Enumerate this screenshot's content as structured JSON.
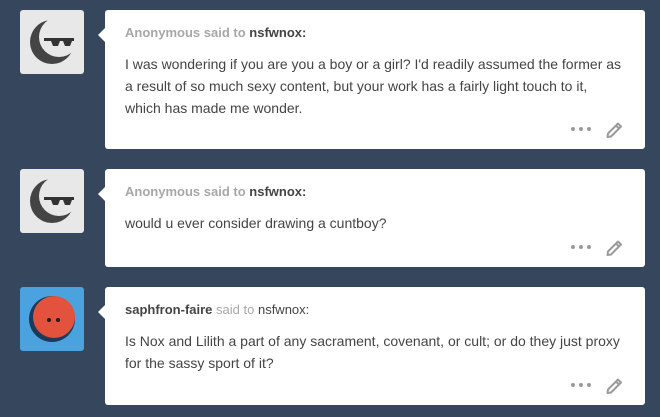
{
  "posts": [
    {
      "asker": "Anonymous",
      "said_to": "said to",
      "recipient": "nsfwnox",
      "colon": ":",
      "question": "I was wondering if you are you a boy or a girl? I'd readily assumed the former as a result of so much sexy content, but your work has a fairly light touch to it, which has made me wonder.",
      "avatar_icon": "anonymous-sunglasses-icon"
    },
    {
      "asker": "Anonymous",
      "said_to": "said to",
      "recipient": "nsfwnox",
      "colon": ":",
      "question": "would u ever consider drawing a cuntboy?",
      "avatar_icon": "anonymous-sunglasses-icon"
    },
    {
      "asker": "saphfron-faire",
      "said_to": "said to",
      "recipient": "nsfwnox",
      "colon": ":",
      "question": "Is Nox and Lilith a part of any sacrament, covenant, or cult; or do they just proxy for the sassy sport of it?",
      "avatar_icon": "orange-face-icon"
    }
  ],
  "colors": {
    "background": "#36465d",
    "card": "#ffffff",
    "text": "#444444",
    "muted": "#a7a7a7",
    "avatar_blue": "#4aa3df",
    "avatar_orange": "#e2523c"
  }
}
